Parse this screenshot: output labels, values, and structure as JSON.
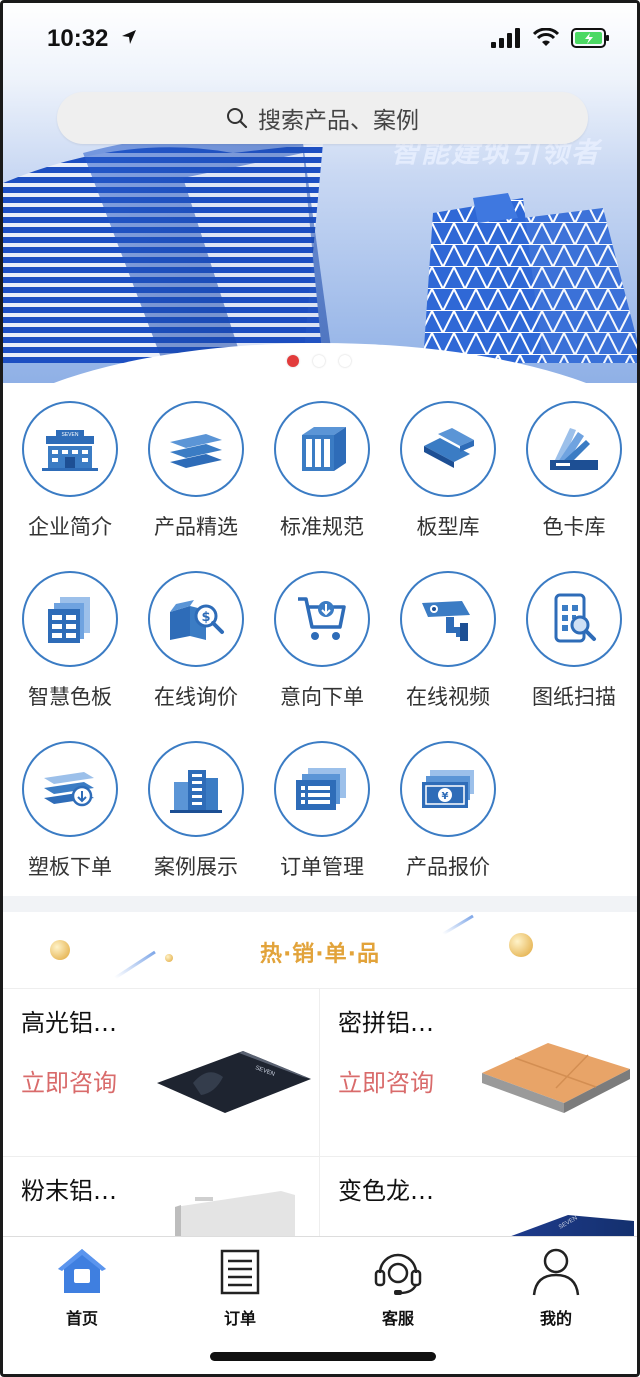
{
  "status": {
    "time": "10:32"
  },
  "banner": {
    "slogan": "智能建筑引领者"
  },
  "search": {
    "placeholder": "搜索产品、案例"
  },
  "carousel": {
    "count": 3,
    "active": 1
  },
  "features": [
    {
      "label": "企业简介",
      "icon": "company-building-icon"
    },
    {
      "label": "产品精选",
      "icon": "product-stack-icon"
    },
    {
      "label": "标准规范",
      "icon": "standard-binder-icon"
    },
    {
      "label": "板型库",
      "icon": "panel-profile-icon"
    },
    {
      "label": "色卡库",
      "icon": "color-card-icon"
    },
    {
      "label": "智慧色板",
      "icon": "smart-palette-icon"
    },
    {
      "label": "在线询价",
      "icon": "price-inquiry-icon"
    },
    {
      "label": "意向下单",
      "icon": "shopping-cart-icon"
    },
    {
      "label": "在线视频",
      "icon": "camera-icon"
    },
    {
      "label": "图纸扫描",
      "icon": "phone-scan-icon"
    },
    {
      "label": "塑板下单",
      "icon": "plastic-panel-order-icon"
    },
    {
      "label": "案例展示",
      "icon": "case-buildings-icon"
    },
    {
      "label": "订单管理",
      "icon": "order-list-icon"
    },
    {
      "label": "产品报价",
      "icon": "money-quote-icon"
    }
  ],
  "hot": {
    "title": "热·销·单·品",
    "products": [
      {
        "name": "高光铝…",
        "cta": "立即咨询"
      },
      {
        "name": "密拼铝…",
        "cta": "立即咨询"
      },
      {
        "name": "粉末铝…",
        "cta": ""
      },
      {
        "name": "变色龙…",
        "cta": ""
      }
    ]
  },
  "tabs": [
    {
      "label": "首页",
      "icon": "home-icon",
      "active": true
    },
    {
      "label": "订单",
      "icon": "order-icon",
      "active": false
    },
    {
      "label": "客服",
      "icon": "headset-icon",
      "active": false
    },
    {
      "label": "我的",
      "icon": "user-icon",
      "active": false
    }
  ],
  "colors": {
    "accent": "#3b7cc4",
    "cta": "#d96b6b",
    "hot_title": "#e2a33a",
    "dot_active": "#e23b3b"
  }
}
